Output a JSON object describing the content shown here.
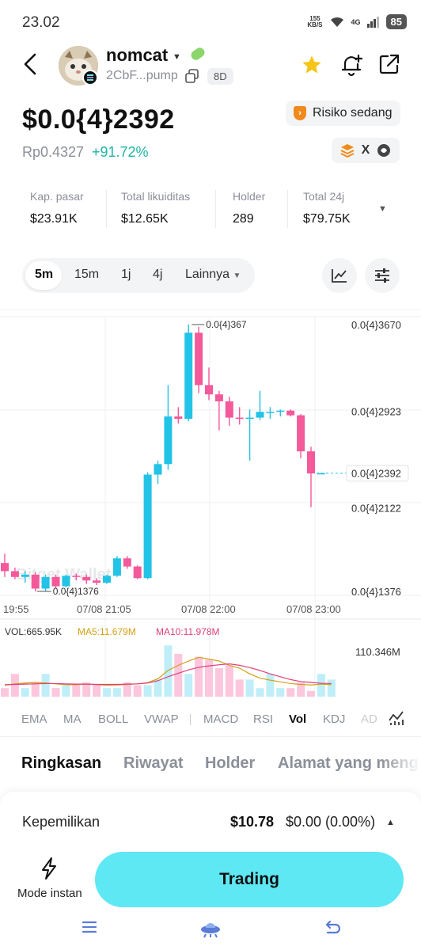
{
  "status": {
    "time": "23.02",
    "speed_top": "155",
    "speed_bottom": "KB/S",
    "network": "4G",
    "battery": "85"
  },
  "header": {
    "token_name": "nomcat",
    "address": "2CbF...pump",
    "age": "8D",
    "icons": [
      "back-icon",
      "star-icon",
      "add-alert-icon",
      "share-icon",
      "copy-icon"
    ],
    "star_color": "#f5c518"
  },
  "price": {
    "value": "$0.0{4}2392",
    "idr": "Rp0.4327",
    "change": "+91.72%",
    "risk": "Risiko sedang",
    "change_color": "#1fb5a6"
  },
  "stats": [
    {
      "label": "Kap. pasar",
      "value": "$23.91K"
    },
    {
      "label": "Total likuiditas",
      "value": "$12.65K"
    },
    {
      "label": "Holder",
      "value": "289"
    },
    {
      "label": "Total 24j",
      "value": "$79.75K"
    }
  ],
  "timeframes": [
    "5m",
    "15m",
    "1j",
    "4j",
    "Lainnya"
  ],
  "chart_data": {
    "type": "candlestick",
    "price_labels": [
      "0.0{4}3670",
      "0.0{4}2923",
      "0.0{4}2392",
      "0.0{4}2122",
      "0.0{4}1376"
    ],
    "high_marker": "0.0{4}367",
    "low_marker": "0.0{4}1376",
    "time_labels": [
      "19:55",
      "07/08 21:05",
      "07/08 22:00",
      "07/08 23:00"
    ],
    "watermark": "Bitget Wallet",
    "up_color": "#22c3e6",
    "down_color": "#f4599a",
    "candles": [
      {
        "o": 1.62,
        "h": 1.7,
        "l": 1.5,
        "c": 1.55
      },
      {
        "o": 1.55,
        "h": 1.58,
        "l": 1.48,
        "c": 1.5
      },
      {
        "o": 1.5,
        "h": 1.55,
        "l": 1.45,
        "c": 1.52
      },
      {
        "o": 1.52,
        "h": 1.54,
        "l": 1.376,
        "c": 1.4
      },
      {
        "o": 1.4,
        "h": 1.52,
        "l": 1.38,
        "c": 1.5
      },
      {
        "o": 1.5,
        "h": 1.52,
        "l": 1.4,
        "c": 1.42
      },
      {
        "o": 1.42,
        "h": 1.52,
        "l": 1.41,
        "c": 1.51
      },
      {
        "o": 1.51,
        "h": 1.53,
        "l": 1.47,
        "c": 1.5
      },
      {
        "o": 1.5,
        "h": 1.52,
        "l": 1.44,
        "c": 1.47
      },
      {
        "o": 1.47,
        "h": 1.49,
        "l": 1.43,
        "c": 1.45
      },
      {
        "o": 1.45,
        "h": 1.52,
        "l": 1.44,
        "c": 1.51
      },
      {
        "o": 1.51,
        "h": 1.68,
        "l": 1.5,
        "c": 1.66
      },
      {
        "o": 1.66,
        "h": 1.68,
        "l": 1.57,
        "c": 1.59
      },
      {
        "o": 1.59,
        "h": 1.6,
        "l": 1.48,
        "c": 1.49
      },
      {
        "o": 1.49,
        "h": 2.4,
        "l": 1.48,
        "c": 2.38
      },
      {
        "o": 2.38,
        "h": 2.5,
        "l": 2.3,
        "c": 2.47
      },
      {
        "o": 2.47,
        "h": 3.15,
        "l": 2.42,
        "c": 2.88
      },
      {
        "o": 2.88,
        "h": 2.96,
        "l": 2.82,
        "c": 2.86
      },
      {
        "o": 2.86,
        "h": 3.67,
        "l": 2.84,
        "c": 3.6
      },
      {
        "o": 3.6,
        "h": 3.65,
        "l": 3.08,
        "c": 3.15
      },
      {
        "o": 3.15,
        "h": 3.3,
        "l": 3.02,
        "c": 3.07
      },
      {
        "o": 3.07,
        "h": 3.1,
        "l": 2.76,
        "c": 3.01
      },
      {
        "o": 3.01,
        "h": 3.05,
        "l": 2.8,
        "c": 2.87
      },
      {
        "o": 2.87,
        "h": 2.96,
        "l": 2.81,
        "c": 2.86
      },
      {
        "o": 2.86,
        "h": 2.94,
        "l": 2.5,
        "c": 2.87
      },
      {
        "o": 2.87,
        "h": 3.1,
        "l": 2.85,
        "c": 2.92
      },
      {
        "o": 2.92,
        "h": 2.96,
        "l": 2.86,
        "c": 2.92
      },
      {
        "o": 2.92,
        "h": 2.94,
        "l": 2.88,
        "c": 2.93
      },
      {
        "o": 2.93,
        "h": 2.94,
        "l": 2.88,
        "c": 2.89
      },
      {
        "o": 2.89,
        "h": 2.9,
        "l": 2.52,
        "c": 2.58
      },
      {
        "o": 2.58,
        "h": 2.62,
        "l": 2.1,
        "c": 2.39
      },
      {
        "o": 2.392,
        "h": 2.395,
        "l": 2.389,
        "c": 2.392
      }
    ],
    "volume": {
      "label": "VOL:665.95K",
      "ma5_label": "MA5:11.679M",
      "ma10_label": "MA10:11.978M",
      "axis_max": "110.346M",
      "ma5_color": "#d4a017",
      "ma10_color": "#e0407a",
      "bars": [
        3,
        8,
        3,
        5,
        8,
        3,
        4,
        4,
        5,
        4,
        3,
        3,
        5,
        4,
        4,
        6,
        18,
        15,
        8,
        14,
        13,
        10,
        11,
        6,
        6,
        3,
        8,
        3,
        3,
        5,
        2,
        8,
        6
      ],
      "ma5": [
        4,
        4.5,
        4.8,
        5,
        4.8,
        4.5,
        4.2,
        4.2,
        4.4,
        4.2,
        4,
        4.1,
        4.3,
        4.5,
        4.9,
        6.3,
        9.2,
        11,
        12.5,
        13.8,
        13.2,
        12.5,
        11,
        10,
        8,
        6.5,
        5.8,
        5.2,
        4.6,
        4.3,
        4.1,
        4.4,
        4.2
      ],
      "ma10": [
        4.2,
        4.3,
        4.4,
        4.5,
        4.6,
        4.6,
        4.5,
        4.4,
        4.4,
        4.3,
        4.3,
        4.3,
        4.4,
        4.5,
        4.8,
        5.6,
        7,
        8.2,
        9.4,
        10.3,
        10.8,
        11.2,
        11.5,
        11,
        10.2,
        9.2,
        8,
        7,
        6,
        5.3,
        5,
        4.7,
        4.6
      ]
    }
  },
  "indicators": [
    "EMA",
    "MA",
    "BOLL",
    "VWAP",
    "MACD",
    "RSI",
    "Vol",
    "KDJ",
    "AD"
  ],
  "tabs": [
    "Ringkasan",
    "Riwayat",
    "Holder",
    "Alamat yang meng"
  ],
  "holdings": {
    "label": "Kepemilikan",
    "value": "$10.78",
    "pnl": "$0.00 (0.00%)"
  },
  "actions": {
    "instant_label": "Mode instan",
    "trade_label": "Trading",
    "trade_color": "#5ee8f4"
  }
}
